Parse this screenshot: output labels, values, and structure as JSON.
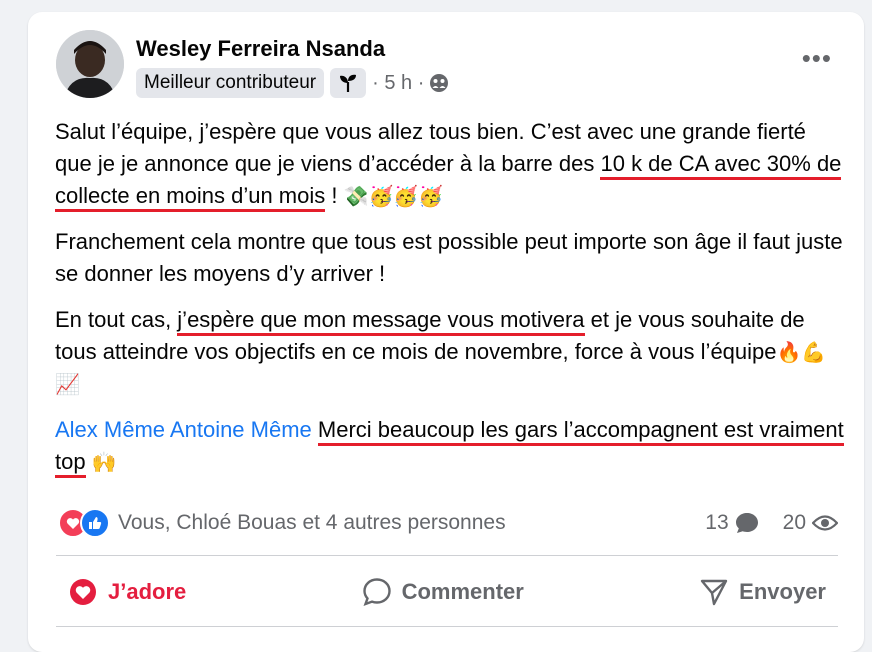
{
  "post": {
    "author": "Wesley Ferreira Nsanda",
    "badge": "Meilleur contributeur",
    "time": "· 5 h ·",
    "more_label": "•••",
    "paragraph1": {
      "text_a": "Salut l’équipe, j’espère que vous allez tous bien. C’est avec une grande fierté que je je annonce que je viens d’accéder à la barre des ",
      "underlined": "10 k de CA avec 30% de collecte en moins d’un mois",
      "text_b": " ! ",
      "emoji": "💸🥳🥳🥳"
    },
    "paragraph2": "Franchement cela montre que tous est possible peut importe son âge il faut juste se donner les moyens d’y arriver !",
    "paragraph3": {
      "text_a": "En tout cas, ",
      "underlined": "j’espère que mon message vous motivera",
      "text_b": " et je vous souhaite de tous atteindre vos objectifs en ce mois de novembre, force à vous l’équipe",
      "emoji": "🔥💪📈"
    },
    "paragraph4": {
      "mention": "Alex Même Antoine Même",
      "underlined": "Merci beaucoup les gars l’accompagnent est vraiment top",
      "emoji": "🙌"
    }
  },
  "reactions": {
    "summary": "Vous, Chloé Bouas et 4 autres personnes",
    "comments_count": "13",
    "views_count": "20"
  },
  "actions": {
    "love": "J’adore",
    "comment": "Commenter",
    "send": "Envoyer"
  },
  "colors": {
    "accent_red": "#e41e3f",
    "mention_blue": "#1877f2",
    "underline_red": "#e41e2b"
  }
}
